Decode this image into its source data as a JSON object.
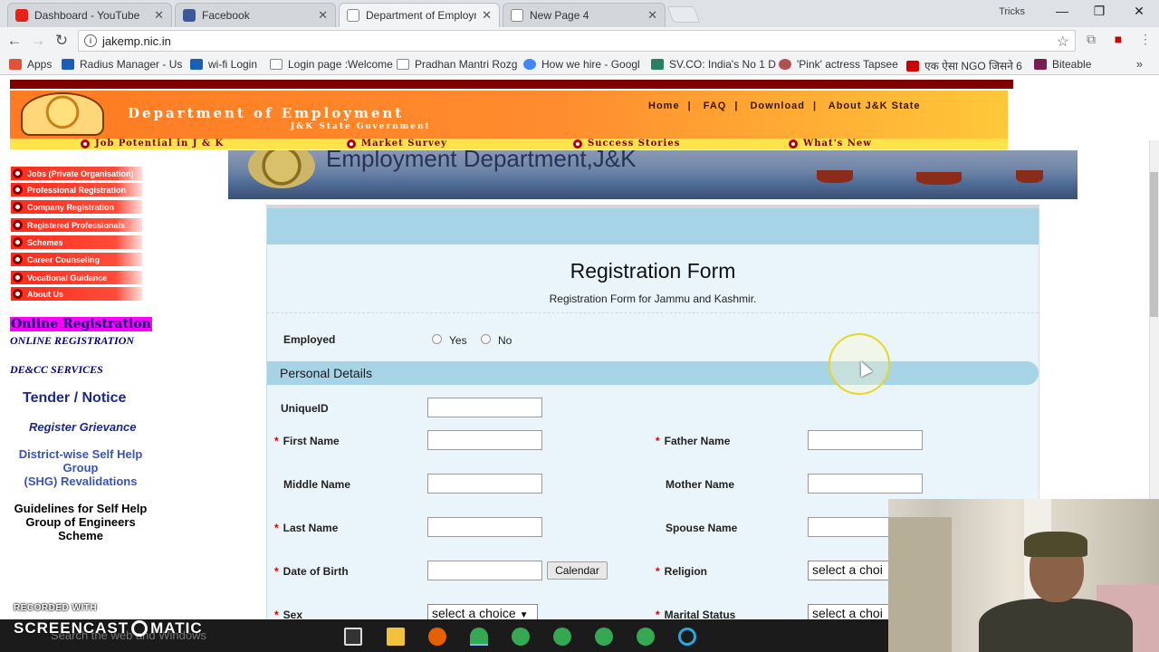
{
  "browser": {
    "tabs": [
      {
        "title": "Dashboard - YouTube",
        "color": "#e62117"
      },
      {
        "title": "Facebook",
        "color": "#3b5998"
      },
      {
        "title": "Department of Employm",
        "color": "#777777"
      },
      {
        "title": "New Page 4",
        "color": "#777777"
      }
    ],
    "window_user": "Tricks",
    "window_controls": [
      "—",
      "❐",
      "✕"
    ],
    "address": "jakemp.nic.in",
    "bookmarks": [
      {
        "label": "Apps",
        "icon": "apps-grid-icon",
        "color": "#e0533a"
      },
      {
        "label": "Radius Manager - Us",
        "icon": "bird-icon",
        "color": "#1a5fb4"
      },
      {
        "label": "wi-fi Login",
        "icon": "bird-icon",
        "color": "#1a5fb4"
      },
      {
        "label": "Login page :Welcome",
        "icon": "page-icon",
        "color": "#888888"
      },
      {
        "label": "Pradhan Mantri Rozg",
        "icon": "page-icon",
        "color": "#888888"
      },
      {
        "label": "How we hire - Googl",
        "icon": "google-icon",
        "color": "#4285f4"
      },
      {
        "label": "SV.CO: India's No 1 D",
        "icon": "shield-icon",
        "color": "#2a7f62"
      },
      {
        "label": "'Pink' actress Tapsee",
        "icon": "circle-icon",
        "color": "#b05050"
      },
      {
        "label": "एक ऐसा NGO जिसने 6",
        "icon": "ys-icon",
        "color": "#cc0000"
      },
      {
        "label": "Biteable",
        "icon": "biteable-icon",
        "color": "#7b1d55"
      }
    ]
  },
  "site": {
    "dept_title": "Department of Employment",
    "dept_subtitle": "J&K State Government",
    "top_nav": [
      "Home",
      "FAQ",
      "Download",
      "About J&K State"
    ],
    "sub_nav": [
      "Job Potential in J & K",
      "Market Survey",
      "Success Stories",
      "What's New"
    ],
    "hero_text": "Employment Department,J&K",
    "sidebar_menu": [
      "Jobs (Private Organisation)",
      "Professional Registration",
      "Company Registration",
      "Registered Professionals",
      "Schemes",
      "Career Counseling",
      "Vocational Guidance",
      "About Us"
    ],
    "sidebar_links": {
      "online_registration": "Online Registration",
      "online_registration_caps": "ONLINE REGISTRATION",
      "decc": "DE&CC SERVICES",
      "tender": "Tender / Notice",
      "grievance": "Register Grievance",
      "district_line1": "District-wise Self Help",
      "district_line2": "Group",
      "district_line3": "(SHG) Revalidations",
      "guidelines_line1": "Guidelines for Self Help",
      "guidelines_line2": "Group of Engineers",
      "guidelines_line3": "Scheme"
    }
  },
  "form": {
    "title": "Registration Form",
    "subtitle": "Registration Form for Jammu and Kashmir.",
    "employed_label": "Employed",
    "employed_options": [
      "Yes",
      "No"
    ],
    "section_personal": "Personal Details",
    "required_mark": "*",
    "fields": {
      "unique_id": "UniqueID",
      "first_name": "First Name",
      "father_name": "Father Name",
      "middle_name": "Middle Name",
      "mother_name": "Mother Name",
      "last_name": "Last Name",
      "spouse_name": "Spouse Name",
      "dob": "Date of Birth",
      "religion": "Religion",
      "sex": "Sex",
      "marital_status": "Marital Status"
    },
    "calendar_button": "Calendar",
    "select_placeholder": "select a choice",
    "select_placeholder_clipped": "select a choi"
  },
  "overlay": {
    "recorded_with": "RECORDED WITH",
    "screencast_1": "SCREENCAST",
    "screencast_2": "MATIC",
    "taskbar_search": "Search the web and Windows"
  },
  "colors": {
    "banner_orange": "#ff7b22",
    "sidebar_red": "#ff2a1a",
    "form_bg": "#e9f5fb",
    "section_blue": "#a6d3e6",
    "maroon": "#800000"
  }
}
